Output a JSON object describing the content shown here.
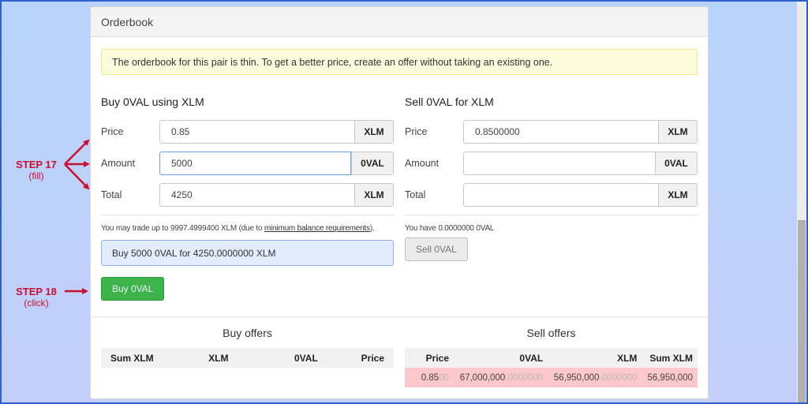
{
  "panel": {
    "title": "Orderbook",
    "notice": "The orderbook for this pair is thin. To get a better price, create an offer without taking an existing one."
  },
  "buy_form": {
    "heading": "Buy 0VAL using XLM",
    "price": {
      "label": "Price",
      "value": "0.85",
      "unit": "XLM"
    },
    "amount": {
      "label": "Amount",
      "value": "5000",
      "unit": "0VAL"
    },
    "total": {
      "label": "Total",
      "value": "4250",
      "unit": "XLM"
    },
    "trade_note_prefix": "You may trade up to 9997.4999400 XLM (due to ",
    "trade_note_link": "minimum balance requirements",
    "trade_note_suffix": ").",
    "summary": "Buy 5000 0VAL for 4250.0000000 XLM",
    "button": "Buy 0VAL"
  },
  "sell_form": {
    "heading": "Sell 0VAL for XLM",
    "price": {
      "label": "Price",
      "value": "0.8500000",
      "unit": "XLM"
    },
    "amount": {
      "label": "Amount",
      "value": "",
      "unit": "0VAL"
    },
    "total": {
      "label": "Total",
      "value": "",
      "unit": "XLM"
    },
    "balance_note": "You have 0.0000000 0VAL",
    "button": "Sell 0VAL"
  },
  "buy_offers": {
    "title": "Buy offers",
    "columns": [
      "Sum XLM",
      "XLM",
      "0VAL",
      "Price"
    ],
    "rows": []
  },
  "sell_offers": {
    "title": "Sell offers",
    "columns": [
      "Price",
      "0VAL",
      "XLM",
      "Sum XLM"
    ],
    "rows": [
      {
        "price": "0.85",
        "price_dim": "00",
        "oval": "67,000,000",
        "oval_dim": ".0000000",
        "xlm": "56,950,000",
        "xlm_dim": ".0000000",
        "sum_xlm": "56,950,000"
      }
    ]
  },
  "annotations": {
    "step17": {
      "label": "STEP 17",
      "action": "(fill)"
    },
    "step18": {
      "label": "STEP 18",
      "action": "(click)"
    }
  },
  "colors": {
    "annotation": "#c8102e",
    "buy_button": "#3cb44a",
    "sell_row": "#fcc8cc",
    "notice_bg": "#fdfbdc"
  }
}
